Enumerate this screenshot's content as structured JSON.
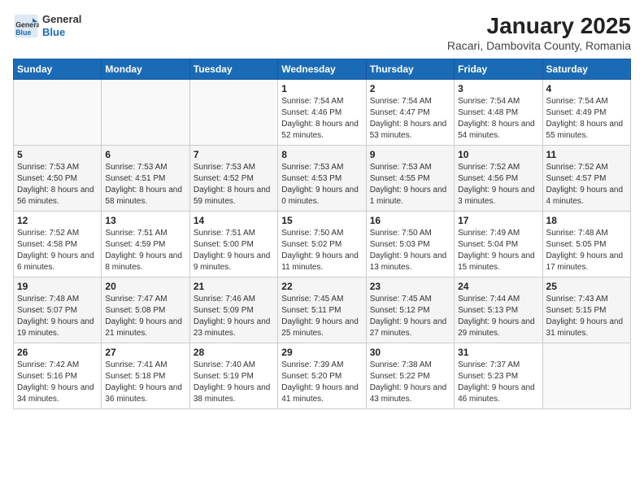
{
  "header": {
    "logo": {
      "general": "General",
      "blue": "Blue"
    },
    "title": "January 2025",
    "subtitle": "Racari, Dambovita County, Romania"
  },
  "calendar": {
    "days_of_week": [
      "Sunday",
      "Monday",
      "Tuesday",
      "Wednesday",
      "Thursday",
      "Friday",
      "Saturday"
    ],
    "weeks": [
      [
        {
          "day": "",
          "info": ""
        },
        {
          "day": "",
          "info": ""
        },
        {
          "day": "",
          "info": ""
        },
        {
          "day": "1",
          "info": "Sunrise: 7:54 AM\nSunset: 4:46 PM\nDaylight: 8 hours and 52 minutes."
        },
        {
          "day": "2",
          "info": "Sunrise: 7:54 AM\nSunset: 4:47 PM\nDaylight: 8 hours and 53 minutes."
        },
        {
          "day": "3",
          "info": "Sunrise: 7:54 AM\nSunset: 4:48 PM\nDaylight: 8 hours and 54 minutes."
        },
        {
          "day": "4",
          "info": "Sunrise: 7:54 AM\nSunset: 4:49 PM\nDaylight: 8 hours and 55 minutes."
        }
      ],
      [
        {
          "day": "5",
          "info": "Sunrise: 7:53 AM\nSunset: 4:50 PM\nDaylight: 8 hours and 56 minutes."
        },
        {
          "day": "6",
          "info": "Sunrise: 7:53 AM\nSunset: 4:51 PM\nDaylight: 8 hours and 58 minutes."
        },
        {
          "day": "7",
          "info": "Sunrise: 7:53 AM\nSunset: 4:52 PM\nDaylight: 8 hours and 59 minutes."
        },
        {
          "day": "8",
          "info": "Sunrise: 7:53 AM\nSunset: 4:53 PM\nDaylight: 9 hours and 0 minutes."
        },
        {
          "day": "9",
          "info": "Sunrise: 7:53 AM\nSunset: 4:55 PM\nDaylight: 9 hours and 1 minute."
        },
        {
          "day": "10",
          "info": "Sunrise: 7:52 AM\nSunset: 4:56 PM\nDaylight: 9 hours and 3 minutes."
        },
        {
          "day": "11",
          "info": "Sunrise: 7:52 AM\nSunset: 4:57 PM\nDaylight: 9 hours and 4 minutes."
        }
      ],
      [
        {
          "day": "12",
          "info": "Sunrise: 7:52 AM\nSunset: 4:58 PM\nDaylight: 9 hours and 6 minutes."
        },
        {
          "day": "13",
          "info": "Sunrise: 7:51 AM\nSunset: 4:59 PM\nDaylight: 9 hours and 8 minutes."
        },
        {
          "day": "14",
          "info": "Sunrise: 7:51 AM\nSunset: 5:00 PM\nDaylight: 9 hours and 9 minutes."
        },
        {
          "day": "15",
          "info": "Sunrise: 7:50 AM\nSunset: 5:02 PM\nDaylight: 9 hours and 11 minutes."
        },
        {
          "day": "16",
          "info": "Sunrise: 7:50 AM\nSunset: 5:03 PM\nDaylight: 9 hours and 13 minutes."
        },
        {
          "day": "17",
          "info": "Sunrise: 7:49 AM\nSunset: 5:04 PM\nDaylight: 9 hours and 15 minutes."
        },
        {
          "day": "18",
          "info": "Sunrise: 7:48 AM\nSunset: 5:05 PM\nDaylight: 9 hours and 17 minutes."
        }
      ],
      [
        {
          "day": "19",
          "info": "Sunrise: 7:48 AM\nSunset: 5:07 PM\nDaylight: 9 hours and 19 minutes."
        },
        {
          "day": "20",
          "info": "Sunrise: 7:47 AM\nSunset: 5:08 PM\nDaylight: 9 hours and 21 minutes."
        },
        {
          "day": "21",
          "info": "Sunrise: 7:46 AM\nSunset: 5:09 PM\nDaylight: 9 hours and 23 minutes."
        },
        {
          "day": "22",
          "info": "Sunrise: 7:45 AM\nSunset: 5:11 PM\nDaylight: 9 hours and 25 minutes."
        },
        {
          "day": "23",
          "info": "Sunrise: 7:45 AM\nSunset: 5:12 PM\nDaylight: 9 hours and 27 minutes."
        },
        {
          "day": "24",
          "info": "Sunrise: 7:44 AM\nSunset: 5:13 PM\nDaylight: 9 hours and 29 minutes."
        },
        {
          "day": "25",
          "info": "Sunrise: 7:43 AM\nSunset: 5:15 PM\nDaylight: 9 hours and 31 minutes."
        }
      ],
      [
        {
          "day": "26",
          "info": "Sunrise: 7:42 AM\nSunset: 5:16 PM\nDaylight: 9 hours and 34 minutes."
        },
        {
          "day": "27",
          "info": "Sunrise: 7:41 AM\nSunset: 5:18 PM\nDaylight: 9 hours and 36 minutes."
        },
        {
          "day": "28",
          "info": "Sunrise: 7:40 AM\nSunset: 5:19 PM\nDaylight: 9 hours and 38 minutes."
        },
        {
          "day": "29",
          "info": "Sunrise: 7:39 AM\nSunset: 5:20 PM\nDaylight: 9 hours and 41 minutes."
        },
        {
          "day": "30",
          "info": "Sunrise: 7:38 AM\nSunset: 5:22 PM\nDaylight: 9 hours and 43 minutes."
        },
        {
          "day": "31",
          "info": "Sunrise: 7:37 AM\nSunset: 5:23 PM\nDaylight: 9 hours and 46 minutes."
        },
        {
          "day": "",
          "info": ""
        }
      ]
    ]
  }
}
